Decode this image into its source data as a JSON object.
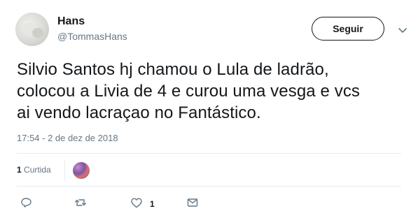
{
  "user": {
    "name": "Hans",
    "handle": "@TommasHans"
  },
  "follow_label": "Seguir",
  "tweet": {
    "text_lines": [
      "Silvio Santos hj chamou o Lula de ladrão,",
      "colocou a Livia de 4 e curou uma vesga e vcs",
      "ai vendo lacraçao no Fantástico."
    ],
    "timestamp": "17:54 - 2 de dez de 2018"
  },
  "stats": {
    "likes_count": "1",
    "likes_label": "Curtida"
  },
  "actions": {
    "like_count": "1"
  },
  "icons": [
    "reply-icon",
    "retweet-icon",
    "like-icon",
    "message-icon",
    "chevron-down-icon"
  ],
  "colors": {
    "text": "#14171a",
    "secondary": "#657786",
    "divider": "#e6ecf0"
  }
}
